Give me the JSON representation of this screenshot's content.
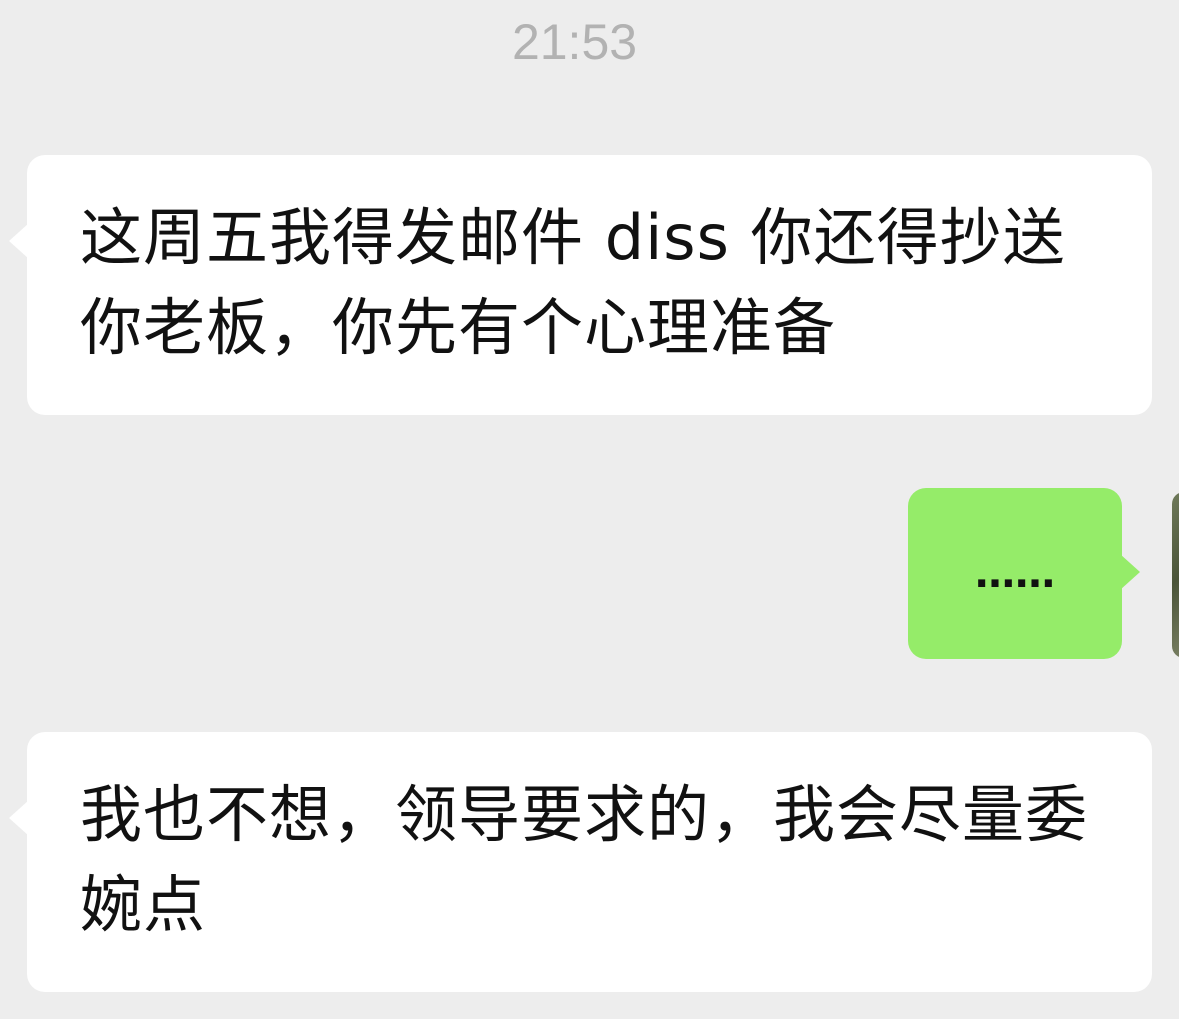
{
  "chat": {
    "timestamp": "21:53",
    "messages": [
      {
        "direction": "incoming",
        "text": "这周五我得发邮件 diss 你还得抄送你老板，你先有个心理准备"
      },
      {
        "direction": "outgoing",
        "text": "……"
      },
      {
        "direction": "incoming",
        "text": "我也不想，领导要求的，我会尽量委婉点"
      }
    ]
  },
  "colors": {
    "background": "#ededed",
    "incoming_bubble": "#ffffff",
    "outgoing_bubble": "#95ec69",
    "timestamp_text": "#b2b2b2",
    "message_text": "#111111"
  }
}
